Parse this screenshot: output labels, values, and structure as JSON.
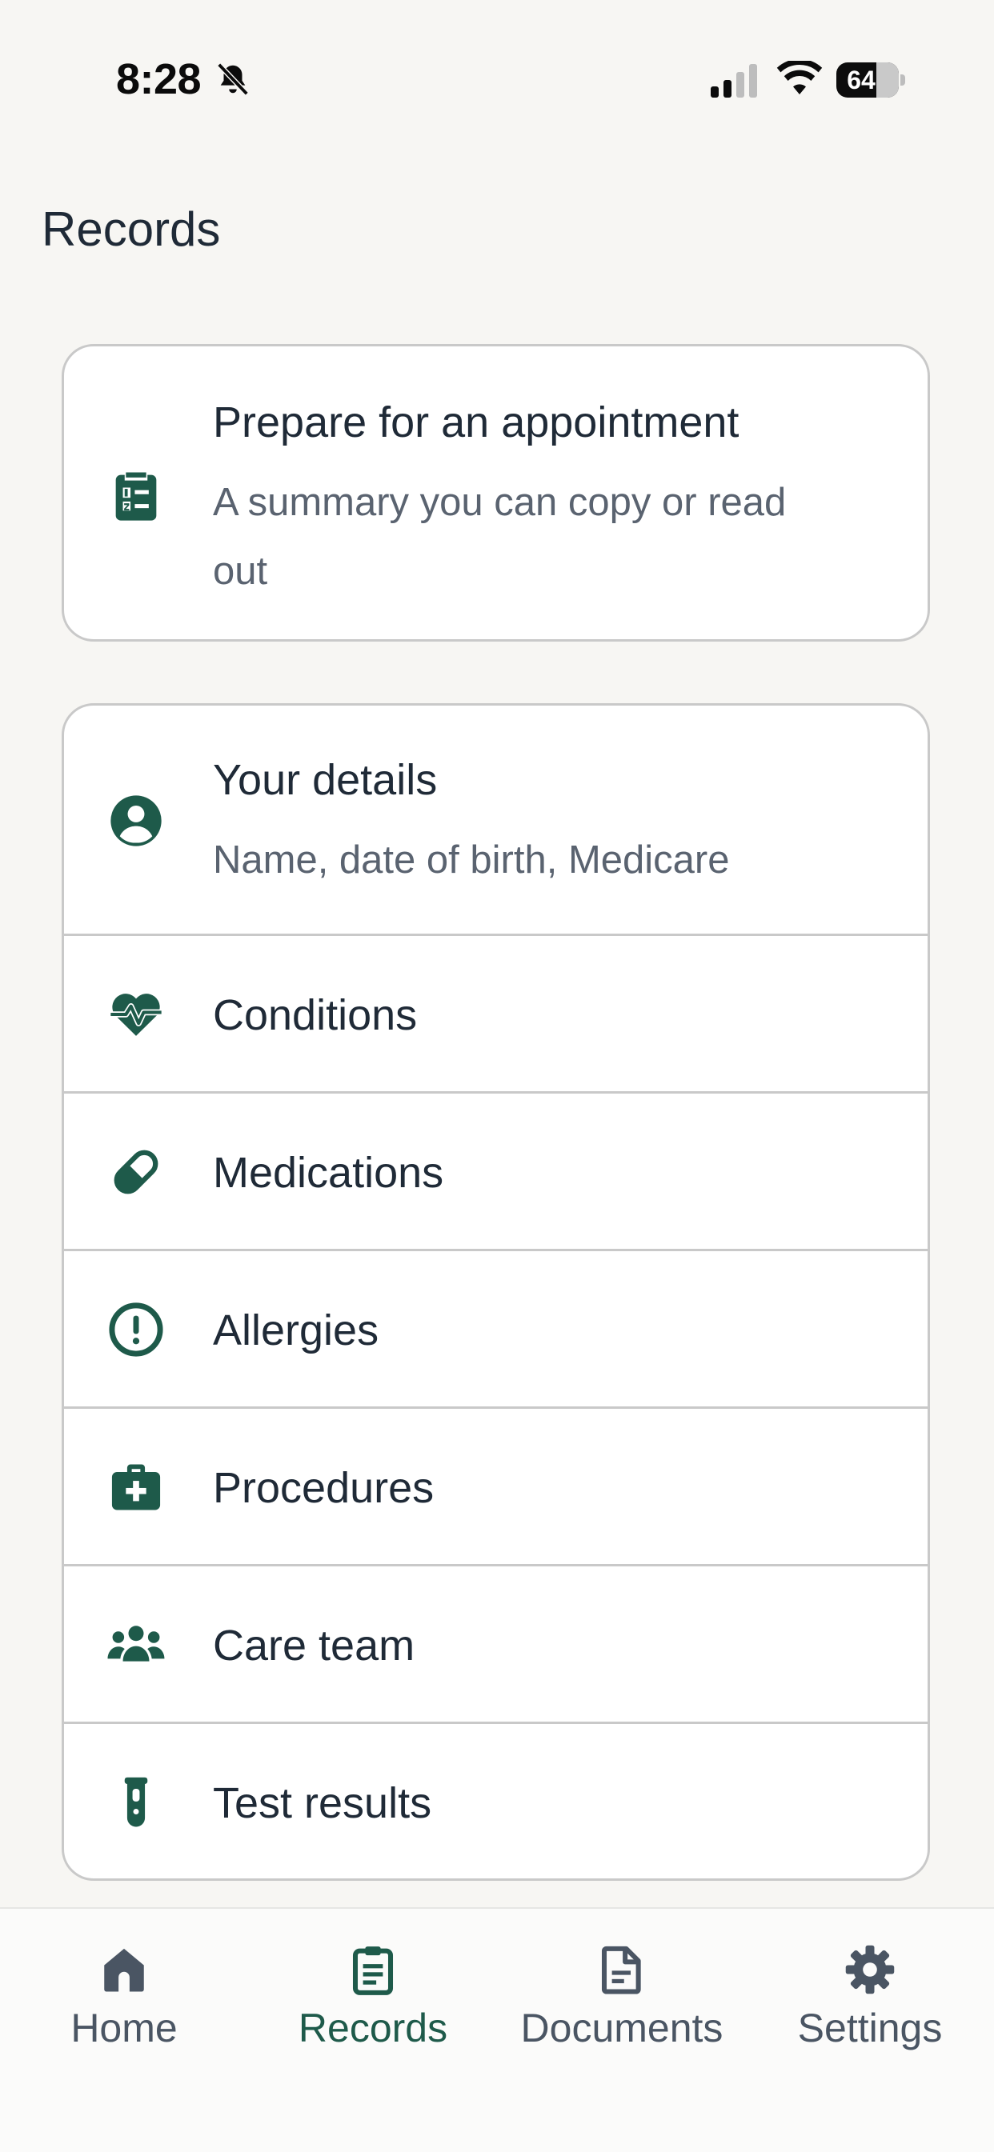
{
  "status_bar": {
    "time": "8:28",
    "battery": "64",
    "battery_level": 0.64
  },
  "page": {
    "title": "Records"
  },
  "prepare_card": {
    "title": "Prepare for an appointment",
    "subtitle_line1": "A summary you can copy or read",
    "subtitle_line2": "out",
    "icon": "clipboard-list-icon"
  },
  "records_list": {
    "your_details": {
      "title": "Your details",
      "subtitle": "Name, date of birth, Medicare",
      "icon": "user-circle-icon"
    },
    "conditions": {
      "label": "Conditions",
      "icon": "heart-pulse-icon"
    },
    "medications": {
      "label": "Medications",
      "icon": "pill-icon"
    },
    "allergies": {
      "label": "Allergies",
      "icon": "exclamation-circle-icon"
    },
    "procedures": {
      "label": "Procedures",
      "icon": "medical-kit-icon"
    },
    "care_team": {
      "label": "Care team",
      "icon": "people-group-icon"
    },
    "test_results": {
      "label": "Test results",
      "icon": "test-tube-icon"
    }
  },
  "bottom_nav": {
    "home": "Home",
    "records": "Records",
    "documents": "Documents",
    "settings": "Settings",
    "active": "Records"
  },
  "colors": {
    "accent": "#1e5a4a",
    "background": "#f7f6f3",
    "text": "#1f2a37",
    "muted": "#5a6370",
    "border": "#c9c9c9"
  }
}
